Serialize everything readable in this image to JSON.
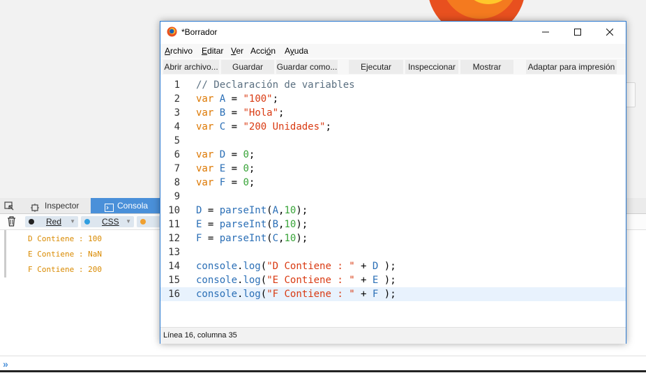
{
  "window": {
    "title": "*Borrador",
    "controls": {
      "minimize": "—",
      "maximize": "☐",
      "close": "✕"
    }
  },
  "menu": {
    "items": [
      {
        "pre": "",
        "key": "A",
        "post": "rchivo"
      },
      {
        "pre": "",
        "key": "E",
        "post": "ditar"
      },
      {
        "pre": "",
        "key": "V",
        "post": "er"
      },
      {
        "pre": "Acci",
        "key": "ó",
        "post": "n"
      },
      {
        "pre": "A",
        "key": "y",
        "post": "uda"
      }
    ]
  },
  "toolbar": {
    "open": "Abrir archivo...",
    "save": "Guardar",
    "save_as": "Guardar como...",
    "run": "Ejecutar",
    "inspect": "Inspeccionar",
    "display": "Mostrar",
    "pretty_print": "Adaptar para impresión"
  },
  "editor": {
    "lines": [
      {
        "n": "1",
        "tokens": [
          {
            "t": "// Declaración de variables",
            "k": "comment"
          }
        ]
      },
      {
        "n": "2",
        "tokens": [
          {
            "t": "var",
            "k": "kw"
          },
          {
            "t": " ",
            "k": "p"
          },
          {
            "t": "A",
            "k": "var"
          },
          {
            "t": " = ",
            "k": "p"
          },
          {
            "t": "\"100\"",
            "k": "str"
          },
          {
            "t": ";",
            "k": "p"
          }
        ]
      },
      {
        "n": "3",
        "tokens": [
          {
            "t": "var",
            "k": "kw"
          },
          {
            "t": " ",
            "k": "p"
          },
          {
            "t": "B",
            "k": "var"
          },
          {
            "t": " = ",
            "k": "p"
          },
          {
            "t": "\"Hola\"",
            "k": "str"
          },
          {
            "t": ";",
            "k": "p"
          }
        ]
      },
      {
        "n": "4",
        "tokens": [
          {
            "t": "var",
            "k": "kw"
          },
          {
            "t": " ",
            "k": "p"
          },
          {
            "t": "C",
            "k": "var"
          },
          {
            "t": " = ",
            "k": "p"
          },
          {
            "t": "\"200 Unidades\"",
            "k": "str"
          },
          {
            "t": ";",
            "k": "p"
          }
        ]
      },
      {
        "n": "5",
        "tokens": []
      },
      {
        "n": "6",
        "tokens": [
          {
            "t": "var",
            "k": "kw"
          },
          {
            "t": " ",
            "k": "p"
          },
          {
            "t": "D",
            "k": "var"
          },
          {
            "t": " = ",
            "k": "p"
          },
          {
            "t": "0",
            "k": "num"
          },
          {
            "t": ";",
            "k": "p"
          }
        ]
      },
      {
        "n": "7",
        "tokens": [
          {
            "t": "var",
            "k": "kw"
          },
          {
            "t": " ",
            "k": "p"
          },
          {
            "t": "E",
            "k": "var"
          },
          {
            "t": " = ",
            "k": "p"
          },
          {
            "t": "0",
            "k": "num"
          },
          {
            "t": ";",
            "k": "p"
          }
        ]
      },
      {
        "n": "8",
        "tokens": [
          {
            "t": "var",
            "k": "kw"
          },
          {
            "t": " ",
            "k": "p"
          },
          {
            "t": "F",
            "k": "var"
          },
          {
            "t": " = ",
            "k": "p"
          },
          {
            "t": "0",
            "k": "num"
          },
          {
            "t": ";",
            "k": "p"
          }
        ]
      },
      {
        "n": "9",
        "tokens": []
      },
      {
        "n": "10",
        "tokens": [
          {
            "t": "D",
            "k": "var"
          },
          {
            "t": " = ",
            "k": "p"
          },
          {
            "t": "parseInt",
            "k": "fn"
          },
          {
            "t": "(",
            "k": "p"
          },
          {
            "t": "A",
            "k": "var"
          },
          {
            "t": ",",
            "k": "p"
          },
          {
            "t": "10",
            "k": "num"
          },
          {
            "t": ");",
            "k": "p"
          }
        ]
      },
      {
        "n": "11",
        "tokens": [
          {
            "t": "E",
            "k": "var"
          },
          {
            "t": " = ",
            "k": "p"
          },
          {
            "t": "parseInt",
            "k": "fn"
          },
          {
            "t": "(",
            "k": "p"
          },
          {
            "t": "B",
            "k": "var"
          },
          {
            "t": ",",
            "k": "p"
          },
          {
            "t": "10",
            "k": "num"
          },
          {
            "t": ");",
            "k": "p"
          }
        ]
      },
      {
        "n": "12",
        "tokens": [
          {
            "t": "F",
            "k": "var"
          },
          {
            "t": " = ",
            "k": "p"
          },
          {
            "t": "parseInt",
            "k": "fn"
          },
          {
            "t": "(",
            "k": "p"
          },
          {
            "t": "C",
            "k": "var"
          },
          {
            "t": ",",
            "k": "p"
          },
          {
            "t": "10",
            "k": "num"
          },
          {
            "t": ");",
            "k": "p"
          }
        ]
      },
      {
        "n": "13",
        "tokens": []
      },
      {
        "n": "14",
        "tokens": [
          {
            "t": "console",
            "k": "fn"
          },
          {
            "t": ".",
            "k": "p"
          },
          {
            "t": "log",
            "k": "fn"
          },
          {
            "t": "(",
            "k": "p"
          },
          {
            "t": "\"D Contiene : \"",
            "k": "str"
          },
          {
            "t": " + ",
            "k": "p"
          },
          {
            "t": "D",
            "k": "var"
          },
          {
            "t": " );",
            "k": "p"
          }
        ]
      },
      {
        "n": "15",
        "tokens": [
          {
            "t": "console",
            "k": "fn"
          },
          {
            "t": ".",
            "k": "p"
          },
          {
            "t": "log",
            "k": "fn"
          },
          {
            "t": "(",
            "k": "p"
          },
          {
            "t": "\"E Contiene : \"",
            "k": "str"
          },
          {
            "t": " + ",
            "k": "p"
          },
          {
            "t": "E",
            "k": "var"
          },
          {
            "t": " );",
            "k": "p"
          }
        ]
      },
      {
        "n": "16",
        "tokens": [
          {
            "t": "console",
            "k": "fn"
          },
          {
            "t": ".",
            "k": "p"
          },
          {
            "t": "log",
            "k": "fn"
          },
          {
            "t": "(",
            "k": "p"
          },
          {
            "t": "\"F Contiene : \"",
            "k": "str"
          },
          {
            "t": " + ",
            "k": "p"
          },
          {
            "t": "F",
            "k": "var"
          },
          {
            "t": " );",
            "k": "p"
          }
        ]
      }
    ],
    "active_line": "16"
  },
  "status": {
    "position": "Línea 16, columna 35"
  },
  "devtools": {
    "tabs": {
      "inspector": "Inspector",
      "console": "Consola"
    },
    "filters": [
      {
        "label": "Red",
        "color": "#222222"
      },
      {
        "label": "CSS",
        "color": "#2f9ee0"
      },
      {
        "label": "",
        "color": "#f0a030"
      }
    ],
    "output": [
      "D Contiene : 100",
      "E Contiene : NaN",
      "F Contiene : 200"
    ],
    "prompt": "»",
    "icons": {
      "picker": "element-picker-icon",
      "trash": "trash-icon"
    }
  }
}
